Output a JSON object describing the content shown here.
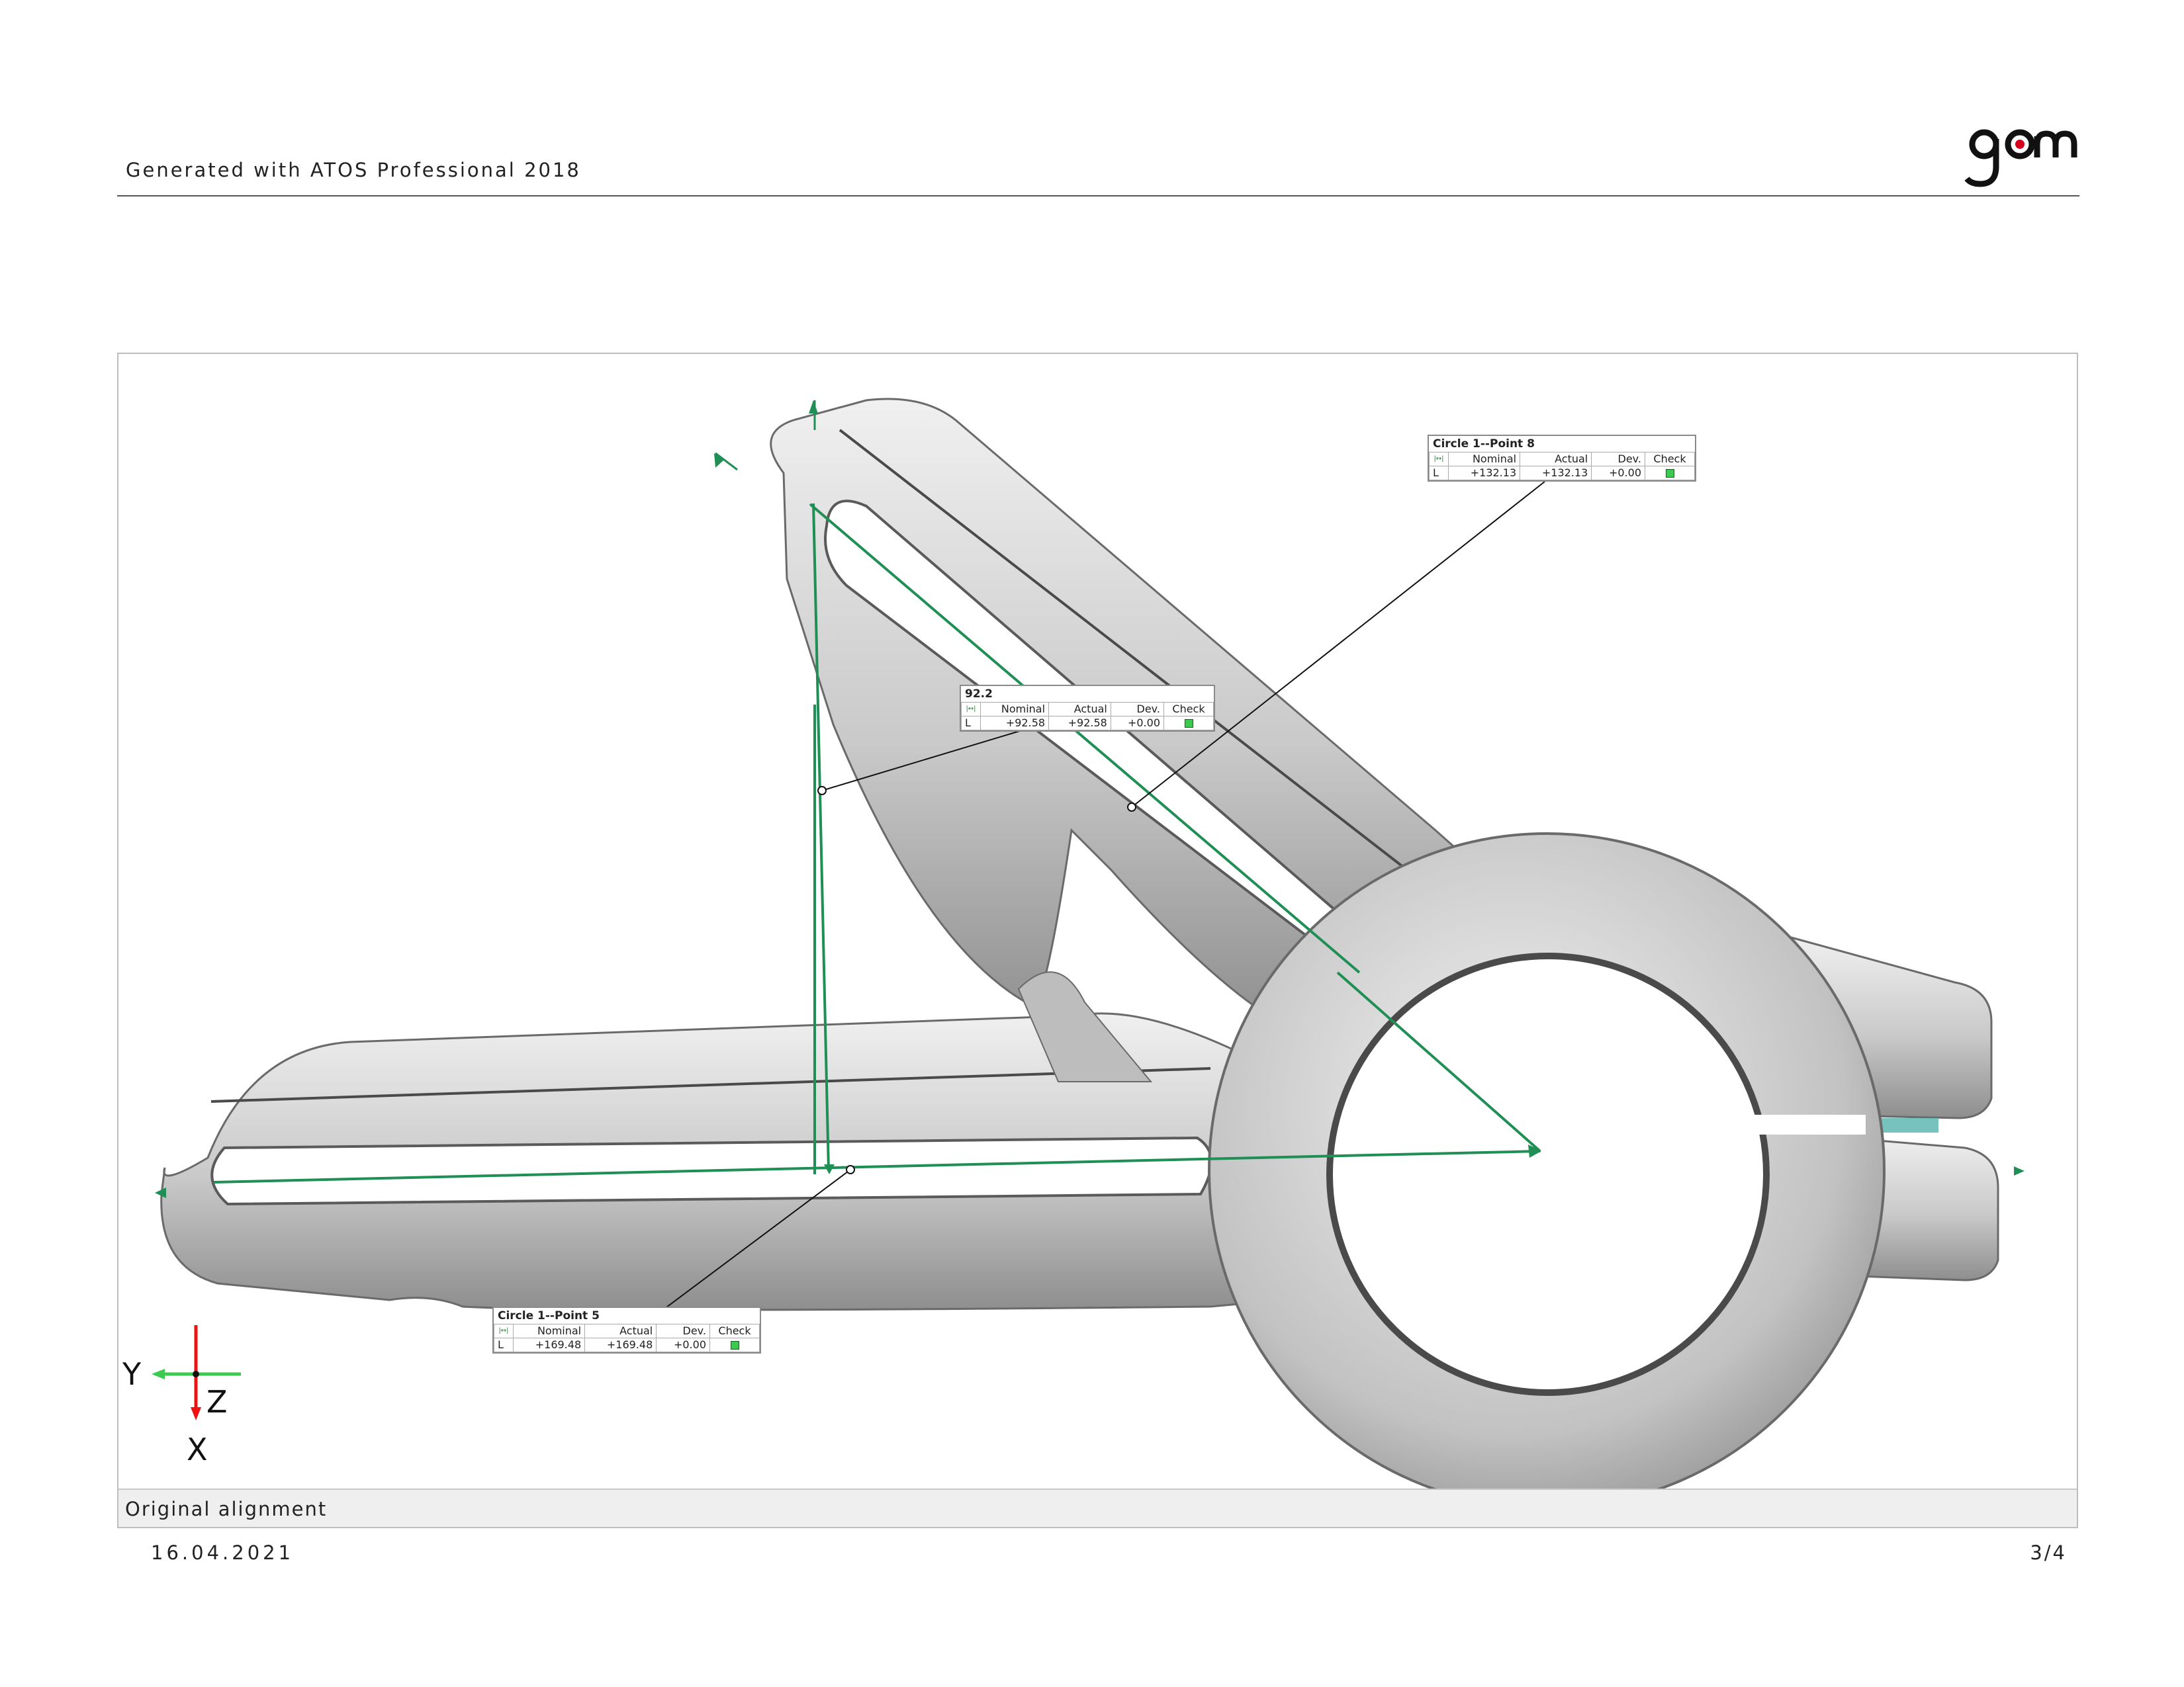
{
  "header": {
    "generated_text": "Generated with ATOS Professional 2018",
    "logo_text": "gom",
    "logo_accent_color": "#d6001c"
  },
  "viewport": {
    "caption": "Original alignment",
    "axes": {
      "y_label": "Y",
      "z_label": "Z",
      "x_label": "X"
    },
    "measurement_color": "#1f8f55",
    "labels": [
      {
        "title": "Circle 1--Point 8",
        "columns": [
          "Nominal",
          "Actual",
          "Dev.",
          "Check"
        ],
        "row": {
          "type": "L",
          "nominal": "+132.13",
          "actual": "+132.13",
          "dev": "+0.00",
          "check": "ok"
        }
      },
      {
        "title": "92.2",
        "columns": [
          "Nominal",
          "Actual",
          "Dev.",
          "Check"
        ],
        "row": {
          "type": "L",
          "nominal": "+92.58",
          "actual": "+92.58",
          "dev": "+0.00",
          "check": "ok"
        }
      },
      {
        "title": "Circle 1--Point 5",
        "columns": [
          "Nominal",
          "Actual",
          "Dev.",
          "Check"
        ],
        "row": {
          "type": "L",
          "nominal": "+169.48",
          "actual": "+169.48",
          "dev": "+0.00",
          "check": "ok"
        }
      }
    ]
  },
  "footer": {
    "date": "16.04.2021",
    "page": "3/4"
  }
}
